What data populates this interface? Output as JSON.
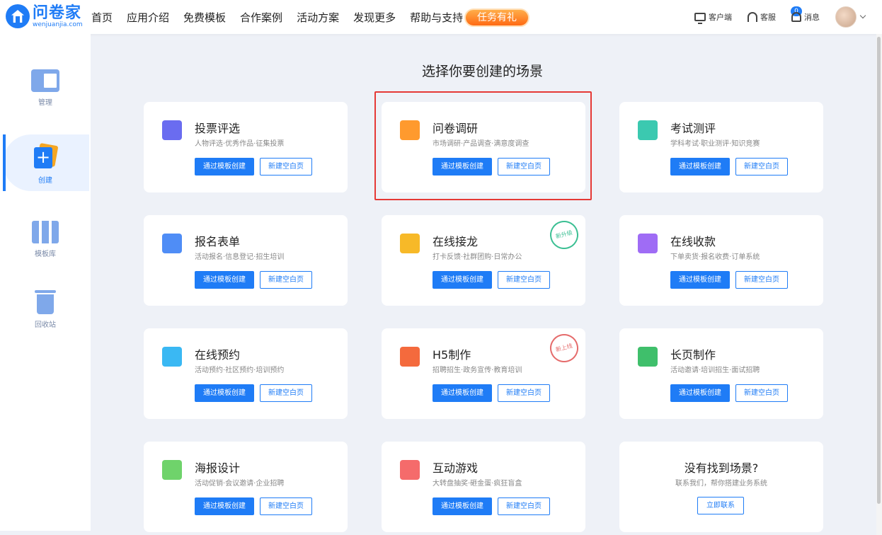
{
  "logo": {
    "name": "问卷家",
    "url": "wenjuanjia.com"
  },
  "nav": [
    "首页",
    "应用介绍",
    "免费模板",
    "合作案例",
    "活动方案",
    "发现更多",
    "帮助与支持"
  ],
  "promo": "任务有礼",
  "header_right": {
    "client": "客户端",
    "service": "客服",
    "messages": "消息",
    "message_count": "0"
  },
  "sidebar": [
    {
      "label": "管理",
      "icon": "manage-icon"
    },
    {
      "label": "创建",
      "icon": "create-icon"
    },
    {
      "label": "模板库",
      "icon": "template-library-icon"
    },
    {
      "label": "回收站",
      "icon": "trash-icon"
    }
  ],
  "page_title": "选择你要创建的场景",
  "buttons": {
    "template": "通过模板创建",
    "blank": "新建空白页",
    "contact": "立即联系"
  },
  "cards": [
    {
      "title": "投票评选",
      "desc": "人物评选·优秀作品·征集投票",
      "icon": "vote-icon",
      "color": "#6a6cf0"
    },
    {
      "title": "问卷调研",
      "desc": "市场调研·产品调查·满意度调查",
      "icon": "survey-icon",
      "color": "#ff9a2e"
    },
    {
      "title": "考试测评",
      "desc": "学科考试·职业测评·知识竞赛",
      "icon": "exam-icon",
      "color": "#3bc9b0"
    },
    {
      "title": "报名表单",
      "desc": "活动报名·信息登记·招生培训",
      "icon": "registration-icon",
      "color": "#4f8df6"
    },
    {
      "title": "在线接龙",
      "desc": "打卡反馈·社群团购·日常办公",
      "icon": "chain-icon",
      "color": "#f7b928"
    },
    {
      "title": "在线收款",
      "desc": "下单卖货·报名收费·订单系统",
      "icon": "payment-icon",
      "color": "#9f6cf5"
    },
    {
      "title": "在线预约",
      "desc": "活动预约·社区预约·培训预约",
      "icon": "appointment-icon",
      "color": "#3ab8f3"
    },
    {
      "title": "H5制作",
      "desc": "招聘招生·政务宣传·教育培训",
      "icon": "h5-icon",
      "color": "#f46a3d"
    },
    {
      "title": "长页制作",
      "desc": "活动邀请·培训招生·面试招聘",
      "icon": "long-page-icon",
      "color": "#3fbf6b"
    },
    {
      "title": "海报设计",
      "desc": "活动促销·会议邀请·企业招聘",
      "icon": "poster-icon",
      "color": "#6fd36b"
    },
    {
      "title": "互动游戏",
      "desc": "大转盘抽奖·砸金蛋·疯狂盲盒",
      "icon": "game-icon",
      "color": "#f56b6b"
    }
  ],
  "stamps": {
    "upgrade": "新升级",
    "new": "新上线"
  },
  "not_found": {
    "title": "没有找到场景?",
    "desc": "联系我们，帮你搭建业务系统"
  }
}
